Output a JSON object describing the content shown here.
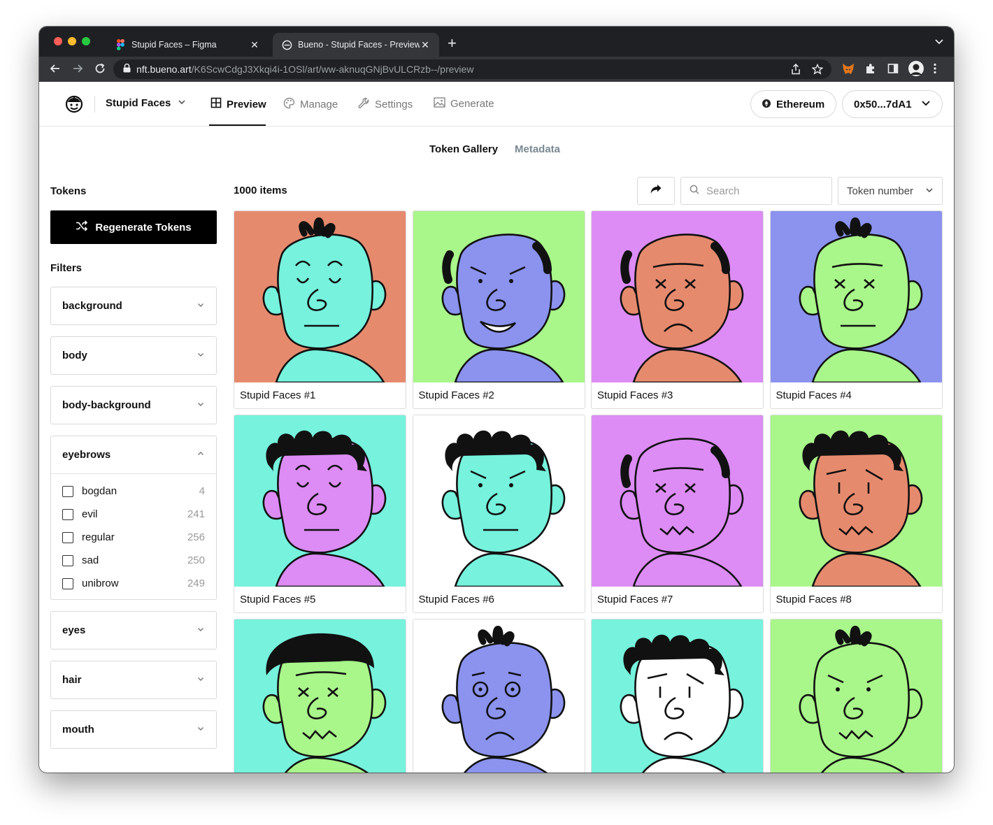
{
  "browser": {
    "tabs": [
      {
        "title": "Stupid Faces – Figma",
        "active": false
      },
      {
        "title": "Bueno - Stupid Faces - Preview",
        "active": true
      }
    ],
    "url_host": "nft.bueno.art",
    "url_path": "/K6ScwCdgJ3Xkqi4i-1OSl/art/ww-aknuqGNjBvULCRzb--/preview",
    "light_colors": [
      "#ff5f57",
      "#febc2e",
      "#28c840"
    ]
  },
  "header": {
    "project_name": "Stupid Faces",
    "nav": [
      {
        "label": "Preview",
        "icon": "grid-icon",
        "active": true
      },
      {
        "label": "Manage",
        "icon": "palette-icon",
        "active": false
      },
      {
        "label": "Settings",
        "icon": "wrench-icon",
        "active": false
      },
      {
        "label": "Generate",
        "icon": "image-icon",
        "active": false
      }
    ],
    "network": "Ethereum",
    "wallet": "0x50...7dA1"
  },
  "subtabs": {
    "gallery": "Token Gallery",
    "metadata": "Metadata"
  },
  "sidebar": {
    "tokens_title": "Tokens",
    "regen_label": "Regenerate Tokens",
    "filters_title": "Filters",
    "filters": [
      {
        "name": "background",
        "expanded": false
      },
      {
        "name": "body",
        "expanded": false
      },
      {
        "name": "body-background",
        "expanded": false
      },
      {
        "name": "eyebrows",
        "expanded": true,
        "options": [
          {
            "label": "bogdan",
            "count": "4"
          },
          {
            "label": "evil",
            "count": "241"
          },
          {
            "label": "regular",
            "count": "256"
          },
          {
            "label": "sad",
            "count": "250"
          },
          {
            "label": "unibrow",
            "count": "249"
          }
        ]
      },
      {
        "name": "eyes",
        "expanded": false
      },
      {
        "name": "hair",
        "expanded": false
      },
      {
        "name": "mouth",
        "expanded": false
      }
    ]
  },
  "gallery": {
    "count_label": "1000 items",
    "search_placeholder": "Search",
    "sort_label": "Token number",
    "tokens": [
      {
        "caption": "Stupid Faces #1",
        "bg": "#e68a6e",
        "skin": "#76f2dd",
        "hair": "tuft",
        "eyes": "closed",
        "mouth": "flat"
      },
      {
        "caption": "Stupid Faces #2",
        "bg": "#a9f68a",
        "skin": "#8b93ef",
        "hair": "bald",
        "eyes": "dots",
        "mouth": "smile"
      },
      {
        "caption": "Stupid Faces #3",
        "bg": "#dc8cf4",
        "skin": "#e68a6e",
        "hair": "bald",
        "eyes": "x",
        "mouth": "frown"
      },
      {
        "caption": "Stupid Faces #4",
        "bg": "#8b93ef",
        "skin": "#a9f68a",
        "hair": "tuft",
        "eyes": "x",
        "mouth": "flat"
      },
      {
        "caption": "Stupid Faces #5",
        "bg": "#76f2dd",
        "skin": "#dc8cf4",
        "hair": "curly",
        "eyes": "closed",
        "mouth": "flat"
      },
      {
        "caption": "Stupid Faces #6",
        "bg": "#ffffff",
        "skin": "#76f2dd",
        "hair": "curly",
        "eyes": "dots",
        "mouth": "flat"
      },
      {
        "caption": "Stupid Faces #7",
        "bg": "#dc8cf4",
        "skin": "#dc8cf4",
        "hair": "bald",
        "eyes": "x",
        "mouth": "zigzag"
      },
      {
        "caption": "Stupid Faces #8",
        "bg": "#a9f68a",
        "skin": "#e68a6e",
        "hair": "curly",
        "eyes": "lines",
        "mouth": "zigzag"
      },
      {
        "caption": "",
        "bg": "#76f2dd",
        "skin": "#a9f68a",
        "hair": "flat",
        "eyes": "x",
        "mouth": "zigzag"
      },
      {
        "caption": "",
        "bg": "#ffffff",
        "skin": "#8b93ef",
        "hair": "tuft",
        "eyes": "circles",
        "mouth": "frown"
      },
      {
        "caption": "",
        "bg": "#76f2dd",
        "skin": "#ffffff",
        "hair": "curly",
        "eyes": "lines",
        "mouth": "frown"
      },
      {
        "caption": "",
        "bg": "#a9f68a",
        "skin": "#a9f68a",
        "hair": "tuft",
        "eyes": "dots",
        "mouth": "zigzag"
      }
    ]
  }
}
